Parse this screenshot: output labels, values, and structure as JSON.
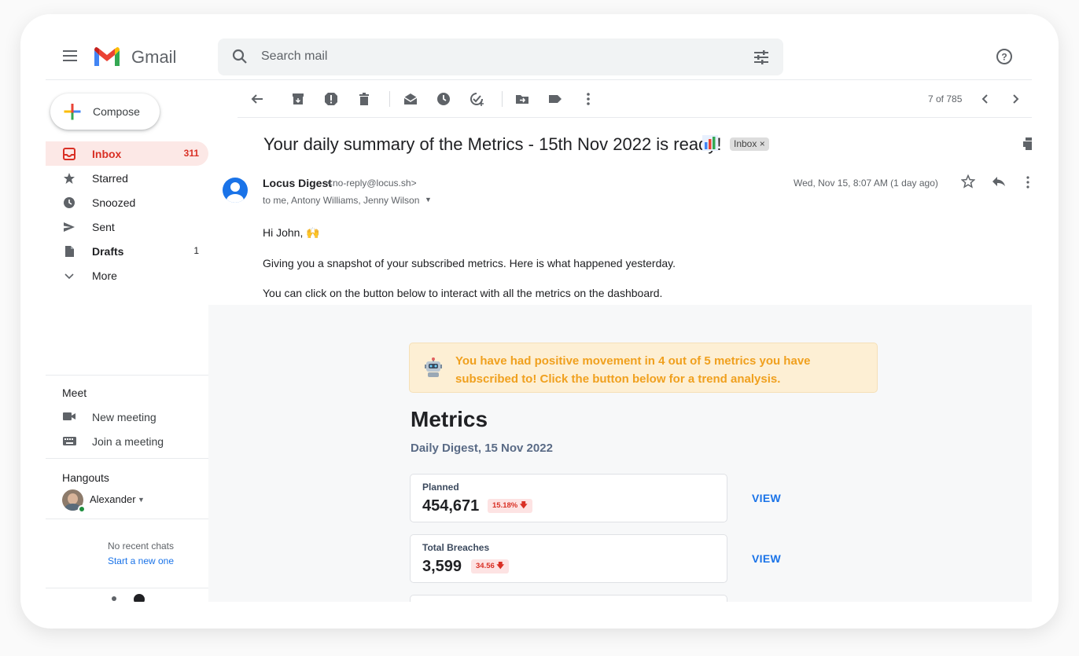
{
  "app": {
    "name": "Gmail"
  },
  "search": {
    "placeholder": "Search mail"
  },
  "compose": {
    "label": "Compose"
  },
  "nav": [
    {
      "label": "Inbox",
      "count": "311",
      "icon": "inbox-icon",
      "active": true
    },
    {
      "label": "Starred",
      "count": "",
      "icon": "star-icon"
    },
    {
      "label": "Snoozed",
      "count": "",
      "icon": "clock-icon"
    },
    {
      "label": "Sent",
      "count": "",
      "icon": "send-icon"
    },
    {
      "label": "Drafts",
      "count": "1",
      "icon": "draft-icon"
    },
    {
      "label": "More",
      "count": "",
      "icon": "chevron-down-icon"
    }
  ],
  "meet": {
    "title": "Meet",
    "items": [
      {
        "label": "New meeting",
        "icon": "video-icon"
      },
      {
        "label": "Join a meeting",
        "icon": "keyboard-icon"
      }
    ]
  },
  "hangouts": {
    "title": "Hangouts",
    "user": "Alexander",
    "empty_text": "No recent chats",
    "start_link": "Start a new one"
  },
  "toolbar": {
    "pager": "7 of 785"
  },
  "email": {
    "subject": "Your daily summary of the Metrics - 15th Nov 2022 is ready!",
    "label_chip": "Inbox ×",
    "sender_name": "Locus Digest",
    "sender_email": "<no-reply@locus.sh>",
    "recipients": "to me, Antony Williams, Jenny Wilson",
    "date": "Wed, Nov 15, 8:07 AM (1 day ago)",
    "greeting": "Hi John, 🙌",
    "line1": "Giving you a snapshot of your subscribed metrics. Here is what happened yesterday.",
    "line2": "You can click on the button below to interact with all the metrics on the dashboard."
  },
  "digest": {
    "alert": "You have had positive movement in 4 out of 5 metrics you have subscribed to! Click the button below for a trend analysis.",
    "title": "Metrics",
    "subtitle": "Daily Digest, 15 Nov 2022",
    "cards": [
      {
        "label": "Planned",
        "value": "454,671",
        "change": "15.18% 🡇",
        "view": "VIEW"
      },
      {
        "label": "Total Breaches",
        "value": "3,599",
        "change": "34.56 🡇",
        "view": "VIEW"
      }
    ]
  },
  "colors": {
    "accent": "#1a73e8",
    "inbox_active": "#d93025",
    "alert_bg": "#fdefd4",
    "alert_text": "#f0a01e"
  }
}
